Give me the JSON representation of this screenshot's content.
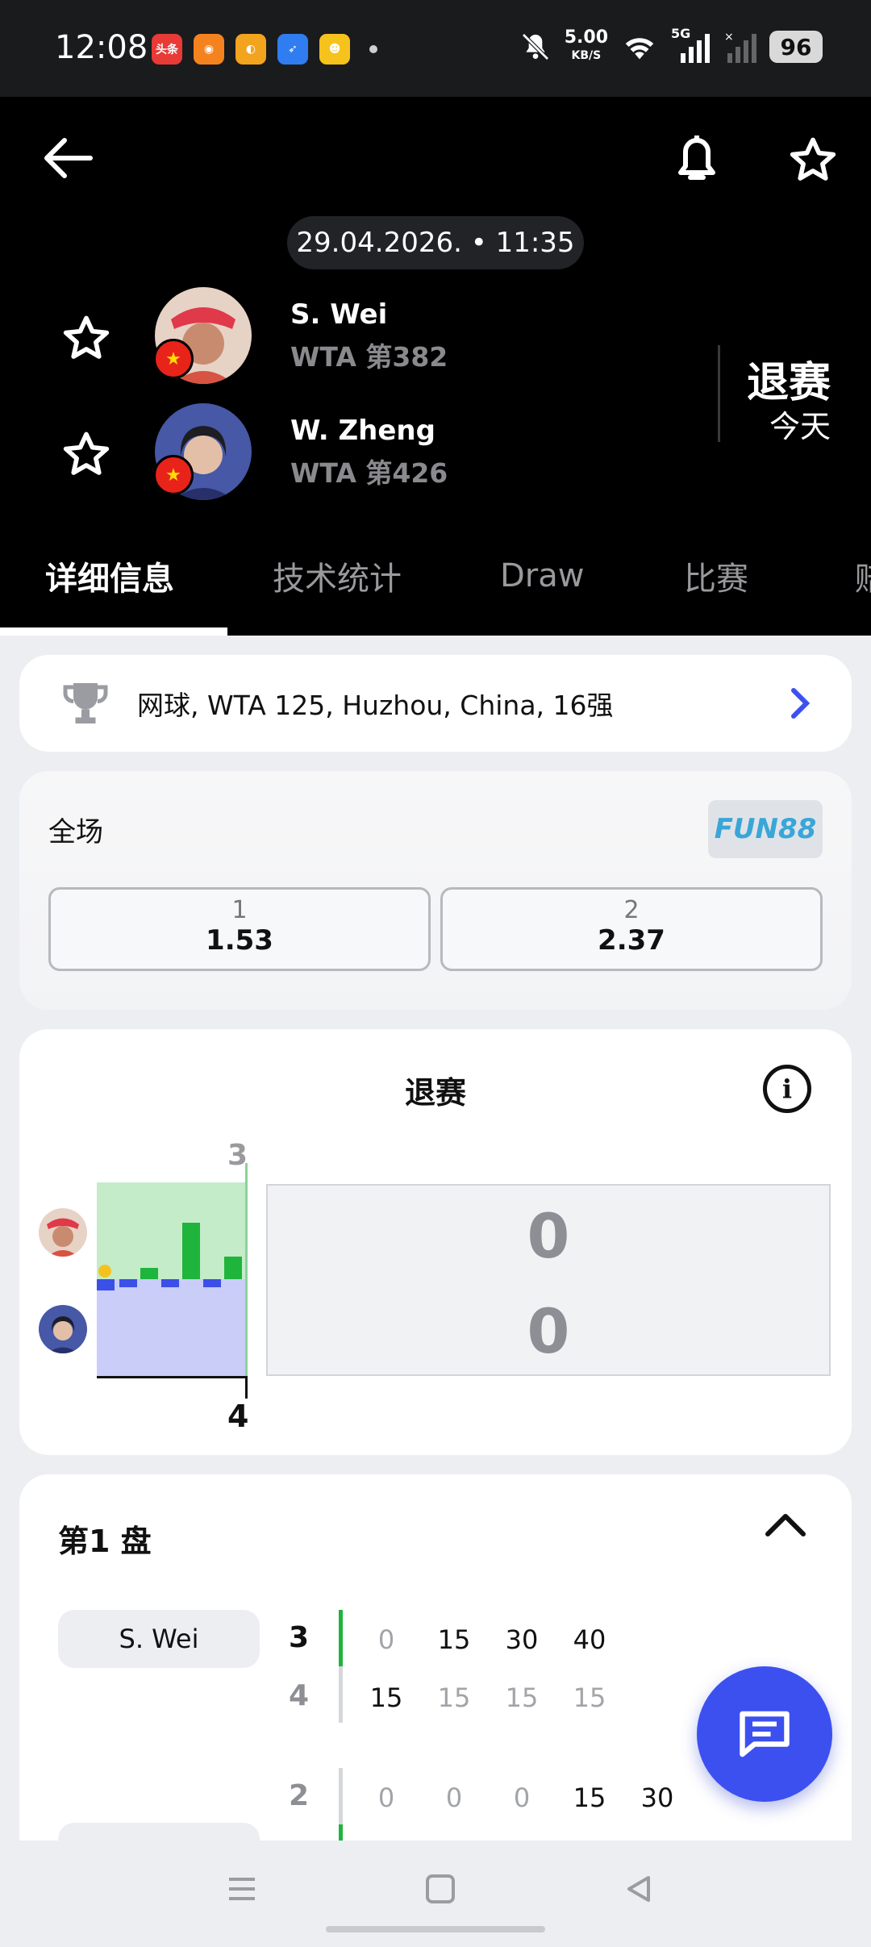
{
  "status_bar": {
    "time": "12:08",
    "app_icons": [
      {
        "name": "toutiao-icon",
        "label": "头条",
        "color": "#e83a36"
      },
      {
        "name": "app-orange-icon",
        "label": "",
        "color": "#f4831f"
      },
      {
        "name": "weibo-icon",
        "label": "",
        "color": "#f2a41e"
      },
      {
        "name": "app-blue-icon",
        "label": "",
        "color": "#2f7df0"
      },
      {
        "name": "app-yellow-icon",
        "label": "",
        "color": "#f6c21c"
      }
    ],
    "net_speed": "5.00",
    "net_unit": "KB/S",
    "signal_label": "5G",
    "battery": "96"
  },
  "header": {
    "datetime": "29.04.2026. • 11:35",
    "players": [
      {
        "name": "S. Wei",
        "rank": "WTA 第382",
        "avatar_color": "#c97862"
      },
      {
        "name": "W. Zheng",
        "rank": "WTA 第426",
        "avatar_color": "#4a5fa8"
      }
    ],
    "status": "退赛",
    "status_sub": "今天"
  },
  "tabs": [
    "详细信息",
    "技术统计",
    "Draw",
    "比赛",
    "赔"
  ],
  "tournament": {
    "text": "网球, WTA 125, Huzhou, China, 16强"
  },
  "odds": {
    "label": "全场",
    "bookmaker": "FUN88",
    "options": [
      {
        "label": "1",
        "value": "1.53"
      },
      {
        "label": "2",
        "value": "2.37"
      }
    ]
  },
  "match_card": {
    "title": "退赛",
    "set_number_top": "3",
    "set_number_bottom": "4",
    "scores": [
      "0",
      "0"
    ],
    "colors": {
      "p1": "#1fb43c",
      "p2": "#3b50e6"
    }
  },
  "sets": {
    "title": "第1 盘",
    "player_label": "S. Wei",
    "games": [
      {
        "score_p1": "3",
        "score_p2": "4",
        "points_p1": [
          "0",
          "15",
          "30",
          "40"
        ],
        "points_p2": [
          "15",
          "15",
          "15",
          "15"
        ]
      },
      {
        "score_p1": "2",
        "points_p1": [
          "0",
          "0",
          "0",
          "15",
          "30"
        ]
      }
    ]
  }
}
